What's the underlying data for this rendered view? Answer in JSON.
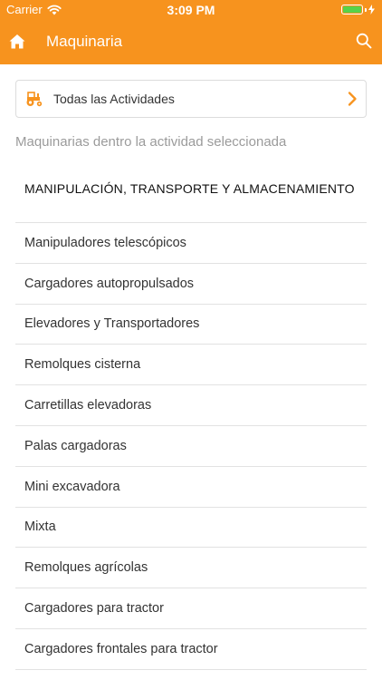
{
  "status_bar": {
    "carrier": "Carrier",
    "time": "3:09 PM",
    "battery_color": "#57d24a"
  },
  "navbar": {
    "title": "Maquinaria",
    "background": "#f7931e",
    "left_icon": "home-icon",
    "right_icon": "search-icon"
  },
  "activity_selector": {
    "icon": "tractor-icon",
    "label": "Todas las Actividades",
    "accent": "#f7931e"
  },
  "subtitle": "Maquinarias dentro la actividad seleccionada",
  "section": {
    "header": "MANIPULACIÓN, TRANSPORTE Y ALMACENAMIENTO",
    "items": [
      "Manipuladores telescópicos",
      "Cargadores autopropulsados",
      "Elevadores y Transportadores",
      "Remolques cisterna",
      "Carretillas elevadoras",
      "Palas cargadoras",
      "Mini excavadora",
      "Mixta",
      "Remolques agrícolas",
      "Cargadores para tractor",
      "Cargadores frontales para tractor"
    ]
  }
}
